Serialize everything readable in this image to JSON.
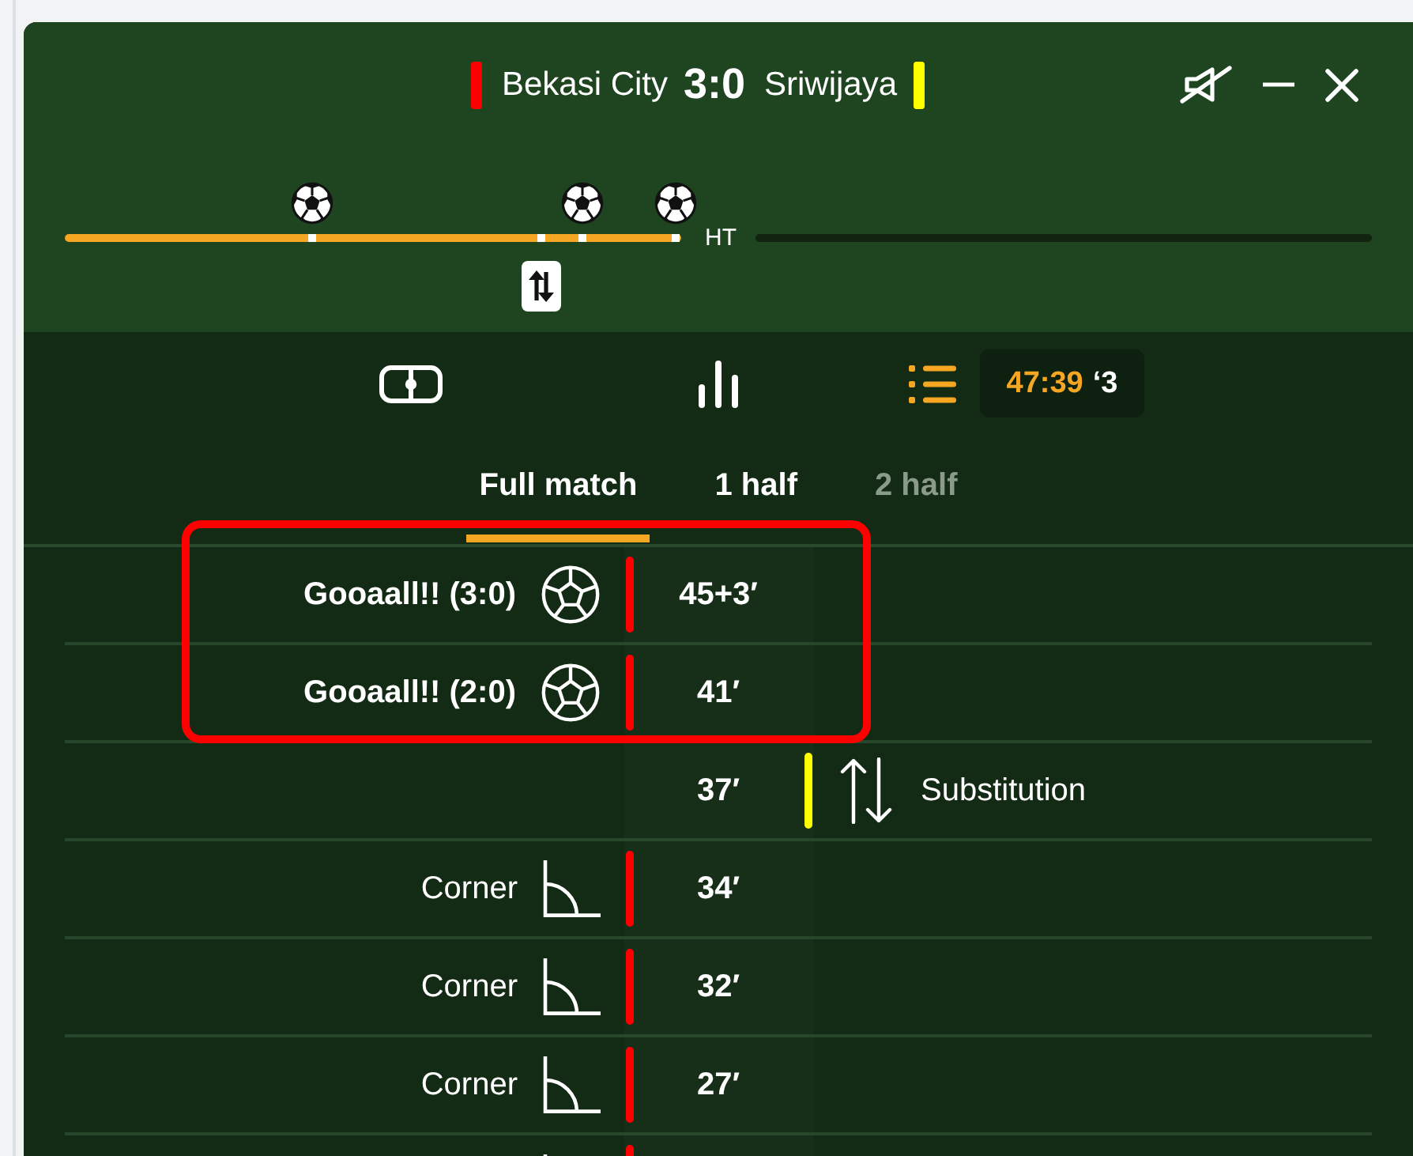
{
  "match": {
    "home": {
      "name": "Bekasi City",
      "color": "#ff0000"
    },
    "score": "3:0",
    "away": {
      "name": "Sriwijaya",
      "color": "#ffff00"
    }
  },
  "window_controls": [
    {
      "kind": "mute"
    },
    {
      "kind": "minimize"
    },
    {
      "kind": "close"
    }
  ],
  "timeline": {
    "first_half": {
      "level": 1,
      "markers": [
        {
          "kind": "goal",
          "level": 0.4
        },
        {
          "kind": "substitution",
          "level": 0.773
        },
        {
          "kind": "goal",
          "level": 0.84
        },
        {
          "kind": "goal",
          "level": 0.992
        }
      ]
    },
    "half_time_label": "HT"
  },
  "view_tabs": [
    {
      "kind": "pitch",
      "selected": false
    },
    {
      "kind": "stats",
      "selected": false
    },
    {
      "kind": "events",
      "selected": true
    }
  ],
  "clock": {
    "time": "47:39",
    "added": "‘3"
  },
  "period_tabs": [
    {
      "label": "Full match",
      "selected": true,
      "disabled": false
    },
    {
      "label": "1 half",
      "selected": false,
      "disabled": false
    },
    {
      "label": "2 half",
      "selected": false,
      "disabled": true
    }
  ],
  "events": [
    {
      "kind": "goal",
      "home": true,
      "color": "#ff0000",
      "label": "Gooaall!! (3:0)",
      "minute": "45+3′",
      "highlighted": true
    },
    {
      "kind": "goal",
      "home": true,
      "color": "#ff0000",
      "label": "Gooaall!! (2:0)",
      "minute": "41′",
      "highlighted": true
    },
    {
      "kind": "substitution",
      "home": false,
      "color": "#ffff00",
      "label": "Substitution",
      "minute": "37′",
      "highlighted": false
    },
    {
      "kind": "corner",
      "home": true,
      "color": "#ff0000",
      "label": "Corner",
      "minute": "34′",
      "highlighted": false
    },
    {
      "kind": "corner",
      "home": true,
      "color": "#ff0000",
      "label": "Corner",
      "minute": "32′",
      "highlighted": false
    },
    {
      "kind": "corner",
      "home": true,
      "color": "#ff0000",
      "label": "Corner",
      "minute": "27′",
      "highlighted": false
    },
    {
      "kind": "corner",
      "home": true,
      "color": "#ff0000",
      "highlighted": false
    }
  ]
}
